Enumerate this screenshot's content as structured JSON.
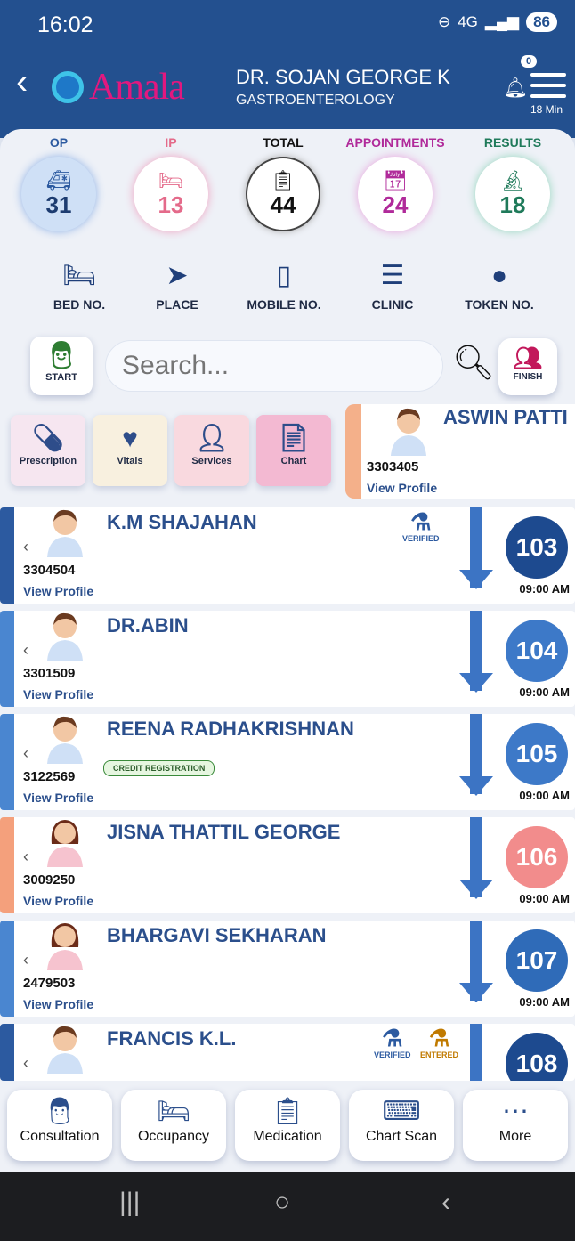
{
  "status_bar": {
    "time": "16:02",
    "network": "4G",
    "battery": "86"
  },
  "header": {
    "app_logo_text": "Amala",
    "doctor_name": "DR. SOJAN GEORGE K",
    "department": "GASTROENTEROLOGY",
    "notification_count": "0",
    "duration": "18 Min"
  },
  "stats": [
    {
      "label": "OP",
      "value": "31",
      "color": "#2c5aa0",
      "icon": "ambulance-icon"
    },
    {
      "label": "IP",
      "value": "13",
      "color": "#e46a8a",
      "icon": "bed-icon"
    },
    {
      "label": "TOTAL",
      "value": "44",
      "color": "#111111",
      "icon": "clipboard-icon"
    },
    {
      "label": "APPOINTMENTS",
      "value": "24",
      "color": "#b02a9a",
      "icon": "calendar-icon"
    },
    {
      "label": "RESULTS",
      "value": "18",
      "color": "#1f7a5a",
      "icon": "microscope-icon"
    }
  ],
  "filters": [
    {
      "label": "BED NO.",
      "icon": "bed-icon"
    },
    {
      "label": "PLACE",
      "icon": "location-arrow-icon"
    },
    {
      "label": "MOBILE NO.",
      "icon": "mobile-icon"
    },
    {
      "label": "CLINIC",
      "icon": "list-icon"
    },
    {
      "label": "TOKEN NO.",
      "icon": "circle-icon"
    }
  ],
  "start_label": "START",
  "search": {
    "placeholder": "Search..."
  },
  "finish_label": "FINISH",
  "actions": [
    {
      "label": "Prescription",
      "icon": "pills-icon",
      "bg": "#f6e6f0"
    },
    {
      "label": "Vitals",
      "icon": "heartbeat-icon",
      "bg": "#f8f0df"
    },
    {
      "label": "Services",
      "icon": "user-nurse-icon",
      "bg": "#f9d9df"
    },
    {
      "label": "Chart",
      "icon": "file-medical-icon",
      "bg": "#f3b9d2"
    }
  ],
  "selected_patient": {
    "name": "ASWIN PATTI",
    "id": "3303405",
    "view_label": "View Profile"
  },
  "patients": [
    {
      "name": "K.M SHAJAHAN",
      "id": "3304504",
      "view_label": "View Profile",
      "token": "103",
      "time": "09:00 AM",
      "token_color": "#1d4a8f",
      "stamps": [
        "VERIFIED"
      ]
    },
    {
      "name": "DR.ABIN",
      "id": "3301509",
      "view_label": "View Profile",
      "token": "104",
      "time": "09:00 AM",
      "token_color": "#3d79c8",
      "stamps": []
    },
    {
      "name": "REENA RADHAKRISHNAN",
      "id": "3122569",
      "view_label": "View Profile",
      "token": "105",
      "time": "09:00 AM",
      "token_color": "#3d79c8",
      "stamps": [],
      "credit": "CREDIT REGISTRATION"
    },
    {
      "name": "JISNA THATTIL GEORGE",
      "id": "3009250",
      "view_label": "View Profile",
      "token": "106",
      "time": "09:00 AM",
      "token_color": "#f28c8c",
      "stamps": []
    },
    {
      "name": "BHARGAVI SEKHARAN",
      "id": "2479503",
      "view_label": "View Profile",
      "token": "107",
      "time": "09:00 AM",
      "token_color": "#2f6bb8",
      "stamps": []
    },
    {
      "name": "FRANCIS K.L.",
      "id": "",
      "view_label": "",
      "token": "108",
      "time": "",
      "token_color": "#1d4a8f",
      "stamps": [
        "VERIFIED",
        "ENTERED"
      ]
    }
  ],
  "bottom_nav": [
    {
      "label": "Consultation",
      "icon": "doctor-icon"
    },
    {
      "label": "Occupancy",
      "icon": "bed-icon"
    },
    {
      "label": "Medication",
      "icon": "clipboard-list-icon"
    },
    {
      "label": "Chart Scan",
      "icon": "scanner-icon"
    },
    {
      "label": "More",
      "icon": "more-dots-icon"
    }
  ]
}
